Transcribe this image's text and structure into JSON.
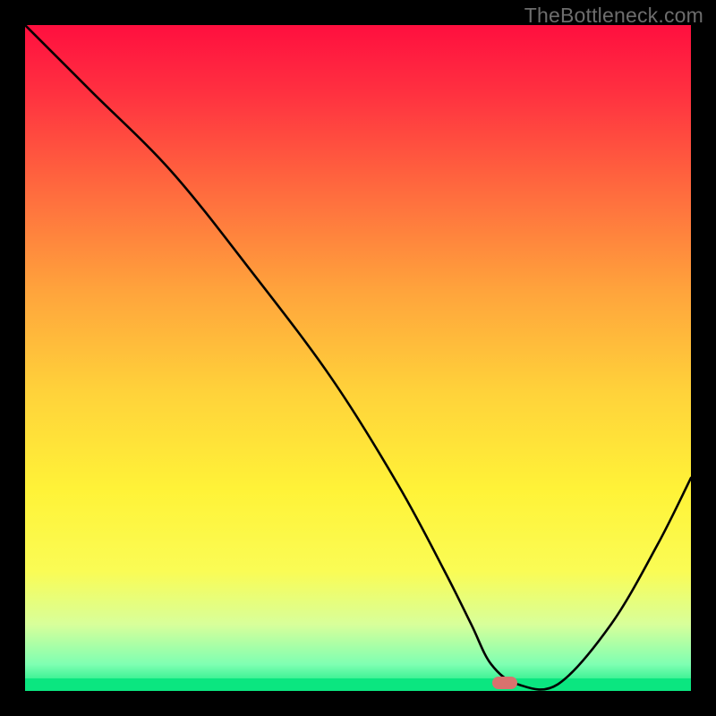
{
  "watermark": "TheBottleneck.com",
  "chart_data": {
    "type": "line",
    "title": "",
    "xlabel": "",
    "ylabel": "",
    "xlim": [
      0,
      100
    ],
    "ylim": [
      0,
      100
    ],
    "grid": false,
    "legend": false,
    "series": [
      {
        "name": "curve",
        "x": [
          0,
          10,
          22,
          34,
          46,
          56,
          63,
          67,
          70,
          74,
          80,
          88,
          95,
          100
        ],
        "y": [
          100,
          90,
          78,
          63,
          47,
          31,
          18,
          10,
          4,
          1,
          1,
          10,
          22,
          32
        ]
      }
    ],
    "marker": {
      "x": 72,
      "y": 1.2,
      "color": "#d9726e"
    },
    "gradient_stops": [
      {
        "pos": 0,
        "color": "#ff0f3f"
      },
      {
        "pos": 25,
        "color": "#ff6b3e"
      },
      {
        "pos": 55,
        "color": "#ffd23a"
      },
      {
        "pos": 82,
        "color": "#fafc55"
      },
      {
        "pos": 100,
        "color": "#0be680"
      }
    ]
  }
}
